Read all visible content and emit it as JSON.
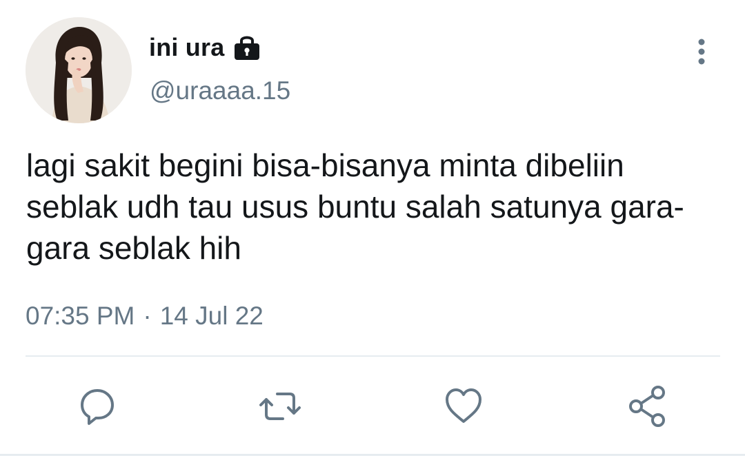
{
  "author": {
    "display_name": "ini ura",
    "handle": "@uraaaa.15",
    "protected": true,
    "avatar_icon": "avatar-photo"
  },
  "tweet": {
    "text": "lagi sakit begini bisa-bisanya minta dibeliin seblak udh tau usus buntu salah satunya gara-gara seblak hih",
    "time": "07:35 PM",
    "separator": "·",
    "date": "14 Jul 22"
  },
  "actions": [
    {
      "name": "reply",
      "icon": "reply-icon"
    },
    {
      "name": "retweet",
      "icon": "retweet-icon"
    },
    {
      "name": "like",
      "icon": "heart-icon"
    },
    {
      "name": "share",
      "icon": "share-icon"
    }
  ],
  "menu": {
    "icon": "more-vertical-icon"
  },
  "colors": {
    "text": "#14171a",
    "secondary": "#657786",
    "divider": "#e6ecf0"
  }
}
